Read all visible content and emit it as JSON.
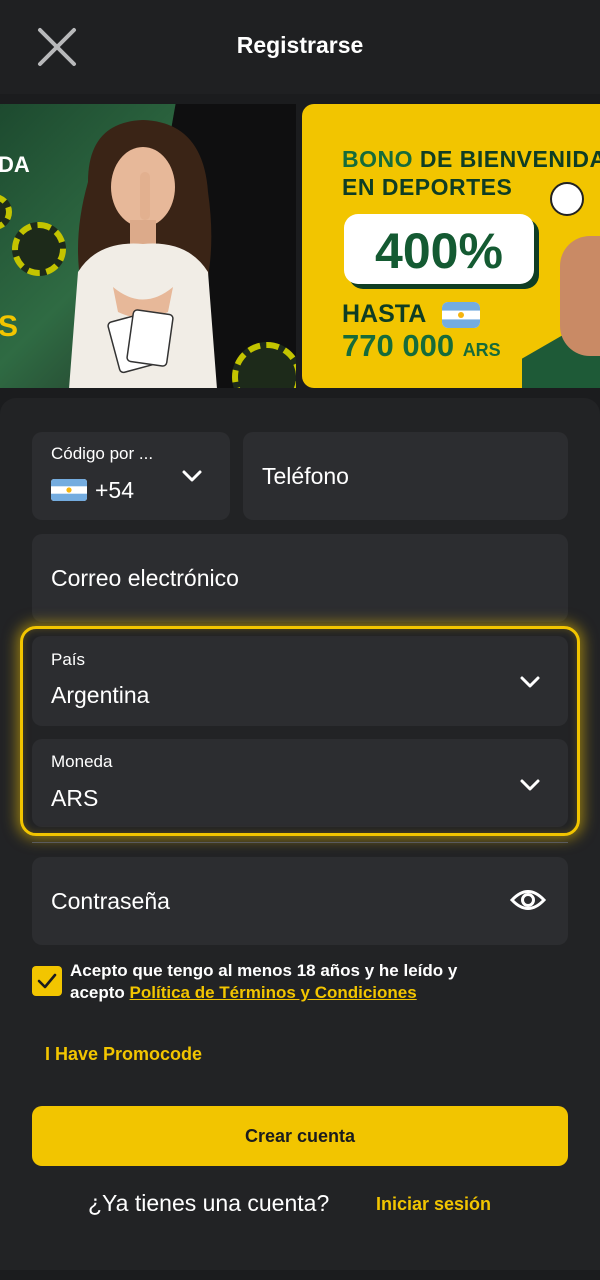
{
  "header": {
    "title": "Registrarse",
    "close_icon": "close-icon"
  },
  "banner": {
    "left_partial_text": "DA",
    "left_partial_s": "S",
    "bono_word": "BONO",
    "bono_rest": "DE BIENVENIDA",
    "line2": "EN DEPORTES",
    "percent": "400%",
    "hasta": "HASTA",
    "amount": "770 000",
    "amount_currency": "ARS"
  },
  "form": {
    "country_code_label": "Código por ...",
    "country_code_value": "+54",
    "phone_placeholder": "Teléfono",
    "email_placeholder": "Correo electrónico",
    "country_label": "País",
    "country_value": "Argentina",
    "currency_label": "Moneda",
    "currency_value": "ARS",
    "password_placeholder": "Contraseña",
    "terms_text": "Acepto que tengo al menos 18 años y he leído y acepto",
    "terms_link": "Política de Términos y Condiciones",
    "terms_checked": true,
    "promo_link": "I Have Promocode",
    "create_button": "Crear cuenta",
    "have_account_text": "¿Ya tienes una cuenta?",
    "login_link": "Iniciar sesión"
  },
  "colors": {
    "accent": "#f2c500",
    "background": "#1b1c1e",
    "field_bg": "#2c2d30",
    "banner_green": "#166b3a"
  }
}
